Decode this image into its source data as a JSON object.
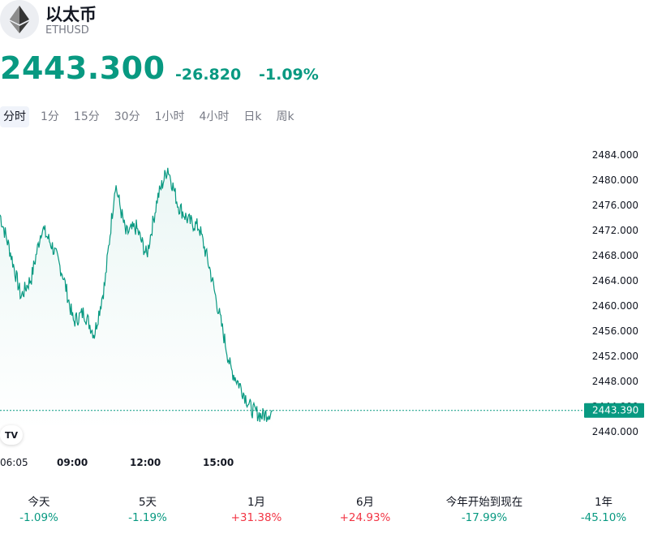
{
  "header": {
    "coin_name": "以太币",
    "symbol": "ETHUSD",
    "icon": "ethereum-icon"
  },
  "quote": {
    "price": "2443.300",
    "change": "-26.820",
    "change_pct": "-1.09%"
  },
  "tabs": [
    {
      "label": "分时",
      "active": true
    },
    {
      "label": "1分",
      "active": false
    },
    {
      "label": "15分",
      "active": false
    },
    {
      "label": "30分",
      "active": false
    },
    {
      "label": "1小时",
      "active": false
    },
    {
      "label": "4小时",
      "active": false
    },
    {
      "label": "日k",
      "active": false
    },
    {
      "label": "周k",
      "active": false
    }
  ],
  "colors": {
    "accent": "#089981",
    "negative_text": "#089981",
    "positive_text": "#f23645",
    "line": "#089981"
  },
  "chart_data": {
    "type": "area",
    "x_ticks": [
      "06:05",
      "09:00",
      "12:00",
      "15:00"
    ],
    "y_ticks": [
      "2484.000",
      "2480.000",
      "2476.000",
      "2472.000",
      "2468.000",
      "2464.000",
      "2460.000",
      "2456.000",
      "2452.000",
      "2448.000",
      "2444.000",
      "2440.000"
    ],
    "ylim": [
      2440,
      2484
    ],
    "last_value_label": "2443.390",
    "last_value": 2443.39,
    "x": [
      "06:05",
      "06:30",
      "07:00",
      "07:30",
      "08:00",
      "08:30",
      "09:00",
      "09:30",
      "10:00",
      "10:30",
      "11:00",
      "11:30",
      "12:00",
      "12:30",
      "13:00",
      "13:30",
      "14:00",
      "14:30",
      "15:00",
      "15:30",
      "16:00",
      "16:15",
      "16:30",
      "16:45",
      "17:00",
      "17:10",
      "17:20"
    ],
    "values": [
      2474.5,
      2468.5,
      2461.5,
      2464.5,
      2472.5,
      2469.5,
      2465.0,
      2457.5,
      2459.0,
      2455.5,
      2463.5,
      2479.5,
      2471.5,
      2472.5,
      2468.0,
      2477.0,
      2482.0,
      2476.0,
      2473.5,
      2472.5,
      2466.0,
      2458.0,
      2450.0,
      2447.0,
      2443.5,
      2442.5,
      2443.3
    ],
    "grid": false,
    "legend": "none"
  },
  "tv_logo": "TV",
  "performance": [
    {
      "label": "今天",
      "value": "-1.09%",
      "sign": "neg"
    },
    {
      "label": "5天",
      "value": "-1.19%",
      "sign": "neg"
    },
    {
      "label": "1月",
      "value": "+31.38%",
      "sign": "pos"
    },
    {
      "label": "6月",
      "value": "+24.93%",
      "sign": "pos"
    },
    {
      "label": "今年开始到现在",
      "value": "-17.99%",
      "sign": "neg"
    },
    {
      "label": "1年",
      "value": "-45.10%",
      "sign": "neg"
    }
  ]
}
